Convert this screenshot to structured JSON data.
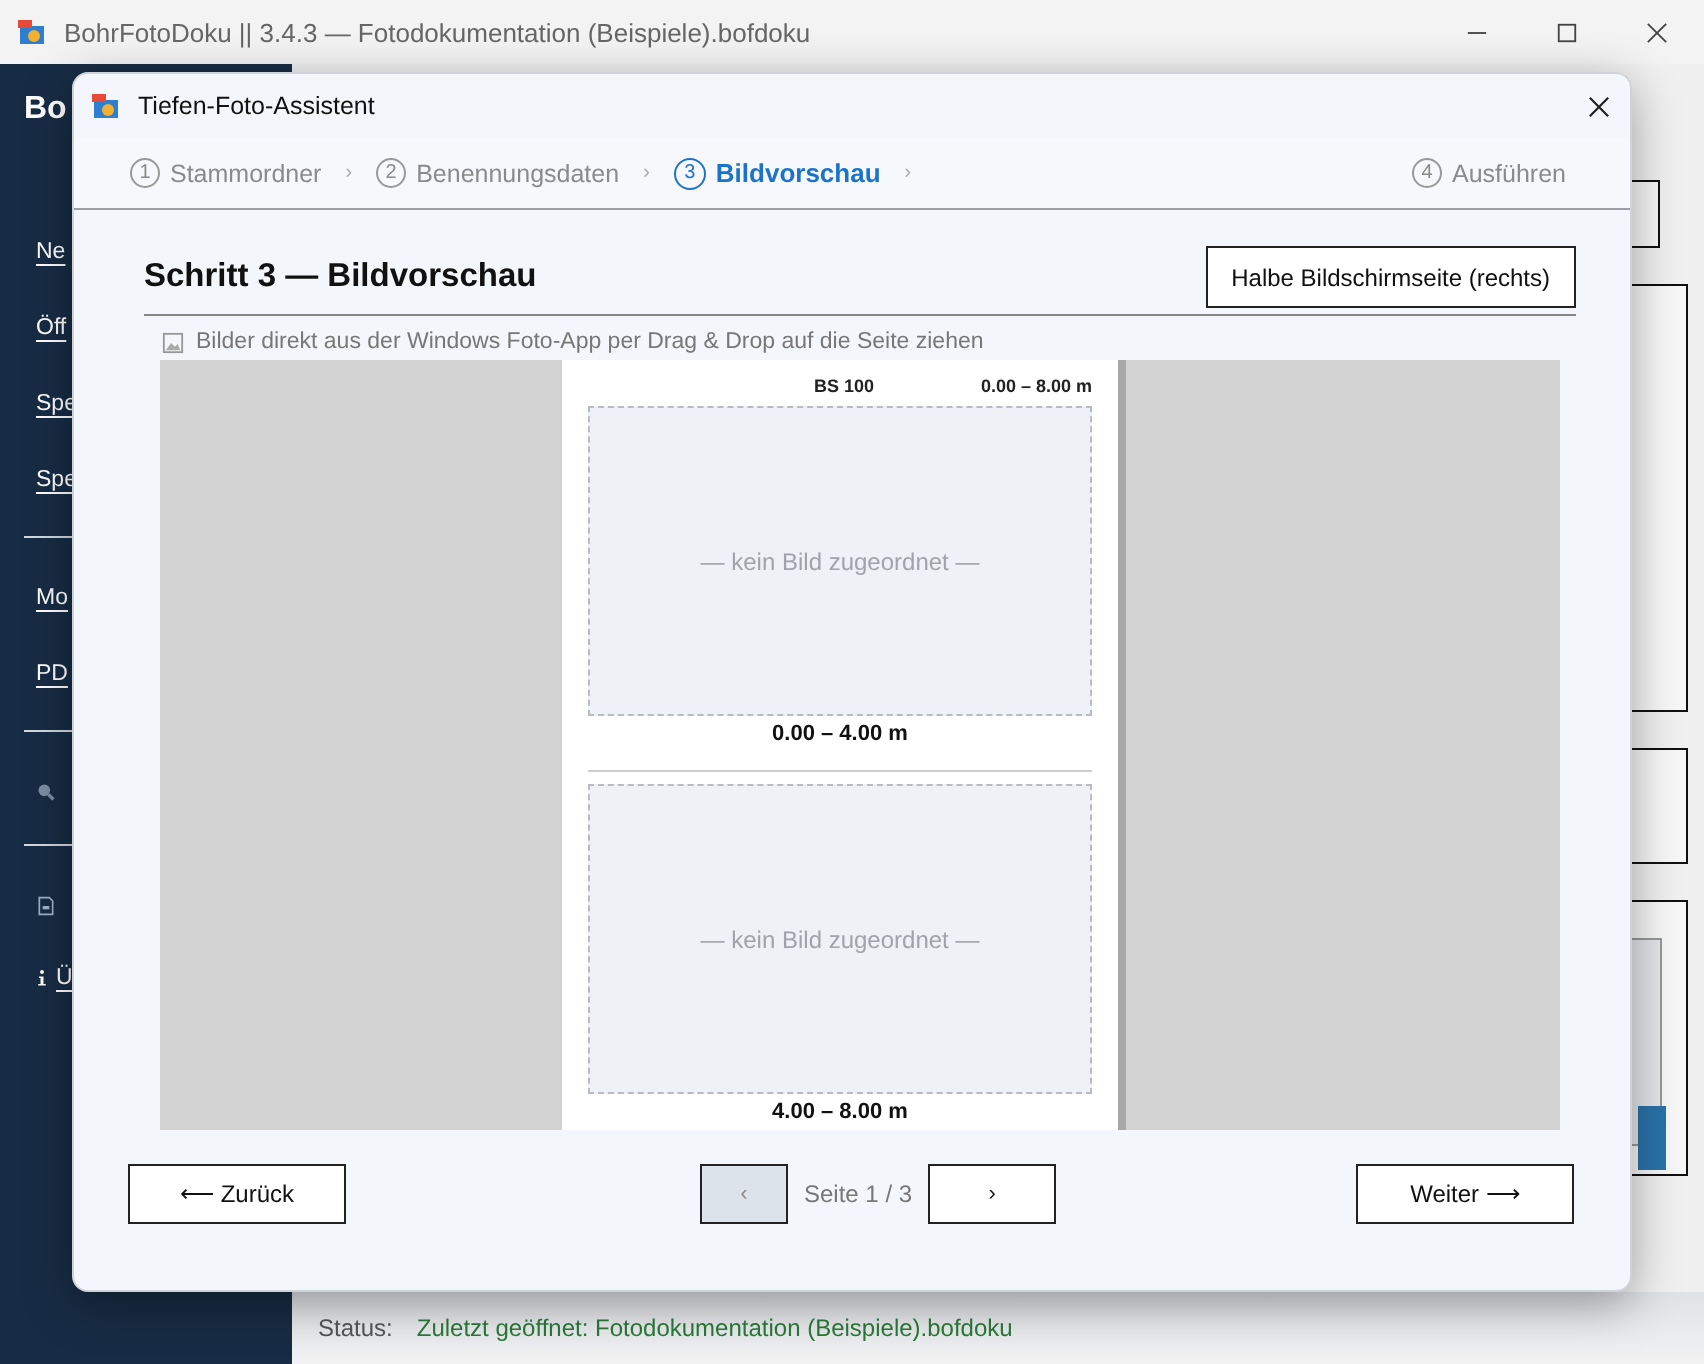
{
  "app_window": {
    "title": "BohrFotoDoku || 3.4.3 — Fotodokumentation (Beispiele).bofdoku"
  },
  "sidebar": {
    "brand": "Bo",
    "items": [
      {
        "kind": "text",
        "label": "Ne"
      },
      {
        "kind": "text",
        "label": "Öff"
      },
      {
        "kind": "text",
        "label": "Spe"
      },
      {
        "kind": "text",
        "label": "Spe"
      },
      {
        "kind": "divider"
      },
      {
        "kind": "text",
        "label": "Mo"
      },
      {
        "kind": "text",
        "label": "PD"
      },
      {
        "kind": "divider"
      },
      {
        "kind": "search"
      },
      {
        "kind": "divider"
      },
      {
        "kind": "doc"
      },
      {
        "kind": "info",
        "label": "Ü"
      }
    ]
  },
  "status_bar": {
    "label": "Status:",
    "message": "Zuletzt geöffnet: Fotodokumentation (Beispiele).bofdoku"
  },
  "dialog": {
    "title": "Tiefen-Foto-Assistent",
    "steps": [
      {
        "number": "1",
        "label": "Stammordner",
        "selected": false,
        "separator": "›"
      },
      {
        "number": "2",
        "label": "Benennungsdaten",
        "selected": false,
        "separator": "›"
      },
      {
        "number": "3",
        "label": "Bildvorschau",
        "selected": true,
        "separator": "›"
      },
      {
        "number": "4",
        "label": "Ausführen",
        "selected": false
      }
    ],
    "heading": "Schritt 3 — Bildvorschau",
    "side_button": "Halbe Bildschirmseite (rechts)",
    "hint": "Bilder direkt aus der Windows Foto-App per Drag & Drop auf die Seite ziehen",
    "page": {
      "header_left": "BS 100",
      "header_right": "0.00 – 8.00 m",
      "slots": [
        {
          "placeholder": "— kein Bild zugeordnet —",
          "caption": "0.00 – 4.00 m"
        },
        {
          "placeholder": "— kein Bild zugeordnet —",
          "caption": "4.00 – 8.00 m"
        }
      ]
    },
    "footer": {
      "back": "⟵ Zurück",
      "prev": {
        "label": "‹",
        "disabled": true
      },
      "page_label": "Seite 1 / 3",
      "next": {
        "label": "›",
        "disabled": false
      },
      "forward": "Weiter ⟶"
    }
  }
}
